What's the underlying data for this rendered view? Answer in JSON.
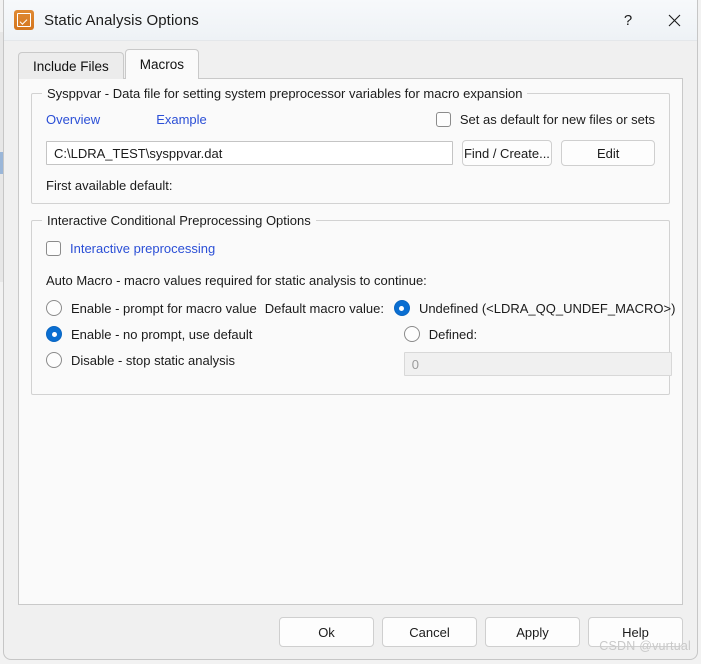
{
  "window": {
    "title": "Static Analysis Options",
    "icon": "checkbox-edit-icon",
    "help_glyph": "?",
    "close_glyph": "✕"
  },
  "tabs": [
    {
      "label": "Include Files",
      "active": false
    },
    {
      "label": "Macros",
      "active": true
    }
  ],
  "sysppvar_group": {
    "legend": "Sysppvar - Data file for setting system preprocessor variables for macro expansion",
    "overview_link": "Overview",
    "example_link": "Example",
    "set_default_checkbox": {
      "label": "Set as default for new files or sets",
      "checked": false
    },
    "path_input": {
      "value": "C:\\LDRA_TEST\\sysppvar.dat",
      "placeholder": ""
    },
    "find_create_button": "Find / Create...",
    "edit_button": "Edit",
    "first_available_default_label": "First available default:"
  },
  "preprocessing_group": {
    "legend": "Interactive Conditional Preprocessing Options",
    "interactive_checkbox": {
      "label": "Interactive preprocessing",
      "checked": false
    },
    "auto_macro_label": "Auto Macro - macro values required for static analysis to continue:",
    "auto_macro_options": [
      {
        "label": "Enable - prompt for macro value",
        "selected": false
      },
      {
        "label": "Enable - no prompt, use default",
        "selected": true
      },
      {
        "label": "Disable - stop static analysis",
        "selected": false
      }
    ],
    "default_macro_label": "Default macro value:",
    "default_macro_options": [
      {
        "label": "Undefined (<LDRA_QQ_UNDEF_MACRO>)",
        "selected": true
      },
      {
        "label": "Defined:",
        "selected": false
      }
    ],
    "defined_value_input": {
      "value": "0",
      "disabled": true
    }
  },
  "footer": {
    "ok": "Ok",
    "cancel": "Cancel",
    "apply": "Apply",
    "help": "Help"
  },
  "watermark": "CSDN @vurtual",
  "colors": {
    "link": "#2b4fd6",
    "radio_accent": "#0a6ed1",
    "icon_orange": "#d4761e",
    "panel_bg": "#fafafa",
    "window_bg": "#f0f0f0"
  }
}
